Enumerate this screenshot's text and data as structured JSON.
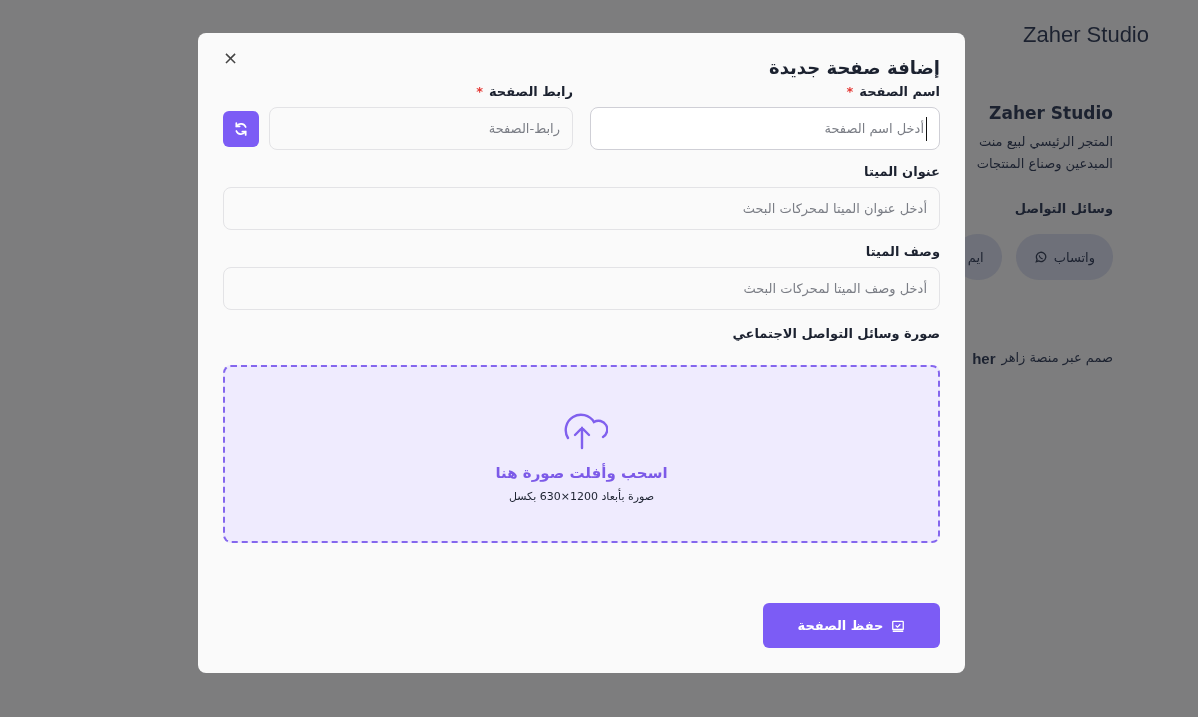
{
  "background_page": {
    "brand": "Zaher Studio",
    "store_name": "Zaher Studio",
    "description_lines": [
      "المتجر الرئيسي لبيع منت",
      "المبدعين وصناع المنتجات"
    ],
    "contact_heading": "وسائل التواصل",
    "contact_buttons": [
      {
        "label": "واتساب",
        "kind": "whatsapp"
      },
      {
        "label": "ايم",
        "kind": "plain"
      }
    ],
    "footer": {
      "text": "صمم عبر منصة زاهر",
      "brand": "her"
    }
  },
  "dialog": {
    "title": "إضافة صفحة جديدة",
    "close": "×",
    "fields": [
      {
        "label": "اسم الصفحة",
        "mark": "*",
        "placeholder": "أدخل اسم الصفحة",
        "focused": true,
        "kind": "half"
      },
      {
        "label": "رابط الصفحة",
        "mark": "*",
        "placeholder": "رابط-الصفحة",
        "focused": false,
        "kind": "half-refresh"
      },
      {
        "label": "عنوان الميتا",
        "placeholder": "أدخل عنوان الميتا لمحركات البحث",
        "focused": false,
        "kind": "full"
      },
      {
        "label": "وصف الميتا",
        "placeholder": "أدخل وصف الميتا لمحركات البحث",
        "focused": false,
        "kind": "full"
      }
    ],
    "image_upload": {
      "label": "صورة وسائل التواصل الاجتماعي",
      "title": "اسحب وأفلت صورة هنا",
      "hint": "صورة بأبعاد 1200×630 بكسل"
    },
    "save_button": "حفظ الصفحة"
  }
}
